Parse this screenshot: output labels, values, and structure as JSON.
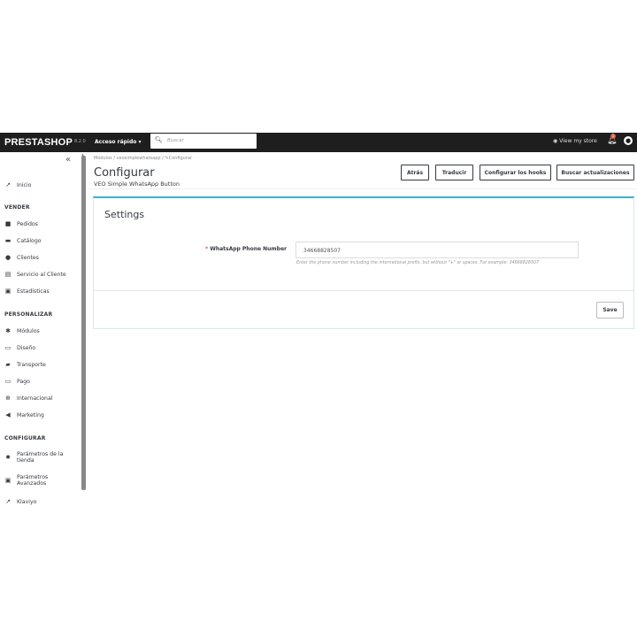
{
  "header": {
    "logo": "PRESTASHOP",
    "version": "8.2.0",
    "quick_access": "Acceso rápido ▾",
    "search_placeholder": "Buscar",
    "view_store": "View my store",
    "notification_count": "1"
  },
  "sidebar": {
    "top_item": "Inicio",
    "sections": [
      {
        "title": "VENDER",
        "items": [
          {
            "icon": "basket-icon",
            "label": "Pedidos"
          },
          {
            "icon": "store-icon",
            "label": "Catálogo"
          },
          {
            "icon": "user-circle-icon",
            "label": "Clientes"
          },
          {
            "icon": "chat-icon",
            "label": "Servicio al Cliente"
          },
          {
            "icon": "chart-icon",
            "label": "Estadísticas"
          }
        ]
      },
      {
        "title": "PERSONALIZAR",
        "items": [
          {
            "icon": "puzzle-icon",
            "label": "Módulos"
          },
          {
            "icon": "monitor-icon",
            "label": "Diseño"
          },
          {
            "icon": "truck-icon",
            "label": "Transporte"
          },
          {
            "icon": "card-icon",
            "label": "Pago"
          },
          {
            "icon": "globe-icon",
            "label": "Internacional"
          },
          {
            "icon": "megaphone-icon",
            "label": "Marketing"
          }
        ]
      },
      {
        "title": "CONFIGURAR",
        "items": [
          {
            "icon": "gear-icon",
            "label": "Parámetros de la tienda"
          },
          {
            "icon": "settings-box-icon",
            "label": "Parámetros Avanzados"
          },
          {
            "icon": "trend-icon",
            "label": "Klaviyo"
          }
        ]
      }
    ]
  },
  "breadcrumb": {
    "a": "Módulos",
    "b": "veosimplewhatsapp",
    "c": "Configurar"
  },
  "page": {
    "title": "Configurar",
    "subtitle": "VEO Simple WhatsApp Button"
  },
  "toolbar": {
    "back": "Atrás",
    "translate": "Traducir",
    "hooks": "Configurar los hooks",
    "updates": "Buscar actualizaciones"
  },
  "form": {
    "title": "Settings",
    "label": "WhatsApp Phone Number",
    "required": "*",
    "value": "34668828507",
    "hint": "Enter the phone number including the international prefix, but without \"+\" or spaces. For example: 34668828507",
    "save": "Save"
  },
  "colors": {
    "topbar": "#1e1e1e",
    "accent": "#25b9d7"
  }
}
